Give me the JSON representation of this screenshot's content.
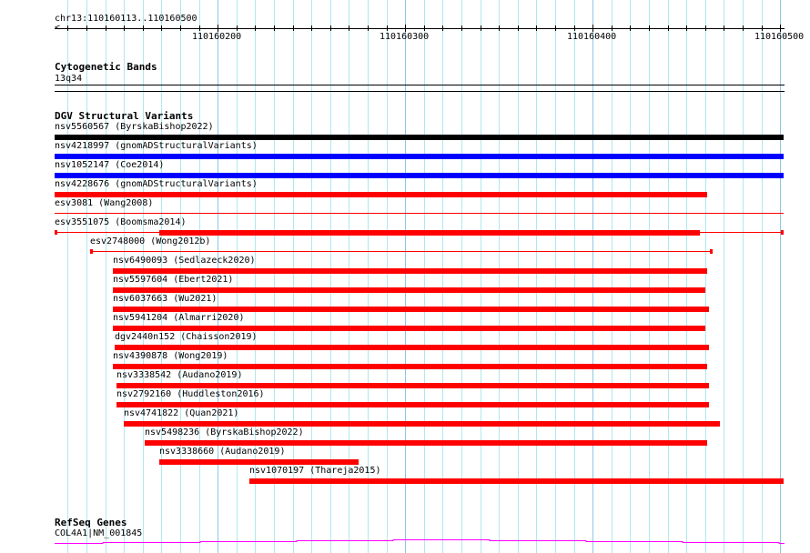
{
  "view": {
    "chrom": "chr13",
    "start": 110160113,
    "end": 110160500,
    "location_label": "chr13:110160113..110160500"
  },
  "ruler": {
    "major_ticks": [
      110160200,
      110160300,
      110160400,
      110160500
    ]
  },
  "tracks": {
    "cytoband": {
      "title": "Cytogenetic Bands",
      "band": "13q34"
    },
    "dgv": {
      "title": "DGV Structural Variants"
    },
    "refseq": {
      "title": "RefSeq Genes",
      "gene": "COL4A1|NM_001845"
    }
  },
  "colors": {
    "red": "#ff0000",
    "blue": "#0000ff",
    "black": "#000000",
    "gene": "#ff00ff"
  },
  "variants": [
    {
      "label": "nsv5560567 (ByrskaBishop2022)",
      "start": 110160113,
      "end": 110160502,
      "color": "black",
      "style": "thick"
    },
    {
      "label": "nsv4218997 (gnomADStructuralVariants)",
      "start": 110160113,
      "end": 110160502,
      "color": "blue",
      "style": "thick"
    },
    {
      "label": "nsv1052147 (Coe2014)",
      "start": 110160113,
      "end": 110160502,
      "color": "blue",
      "style": "thick"
    },
    {
      "label": "nsv4228676 (gnomADStructuralVariants)",
      "start": 110160113,
      "end": 110160461,
      "color": "red",
      "style": "thick"
    },
    {
      "label": "esv3081 (Wang2008)",
      "start": 110160113,
      "end": 110160502,
      "color": "red",
      "style": "thin"
    },
    {
      "label": "esv3551075 (Boomsma2014)",
      "start": 110160113,
      "end": 110160502,
      "color": "red",
      "style": "capped",
      "thick_start": 110160169,
      "thick_end": 110160457
    },
    {
      "label": "esv2748000 (Wong2012b)",
      "start": 110160132,
      "end": 110160464,
      "color": "red",
      "style": "capped"
    },
    {
      "label": "nsv6490093 (Sedlazeck2020)",
      "start": 110160144,
      "end": 110160461,
      "color": "red",
      "style": "thick"
    },
    {
      "label": "nsv5597604 (Ebert2021)",
      "start": 110160144,
      "end": 110160460,
      "color": "red",
      "style": "thick"
    },
    {
      "label": "nsv6037663 (Wu2021)",
      "start": 110160144,
      "end": 110160462,
      "color": "red",
      "style": "thick"
    },
    {
      "label": "nsv5941204 (Almarri2020)",
      "start": 110160144,
      "end": 110160460,
      "color": "red",
      "style": "thick"
    },
    {
      "label": "dgv2440n152 (Chaisson2019)",
      "start": 110160145,
      "end": 110160462,
      "color": "red",
      "style": "thick"
    },
    {
      "label": "nsv4390878 (Wong2019)",
      "start": 110160144,
      "end": 110160461,
      "color": "red",
      "style": "thick"
    },
    {
      "label": "nsv3338542 (Audano2019)",
      "start": 110160146,
      "end": 110160462,
      "color": "red",
      "style": "thick"
    },
    {
      "label": "nsv2792160 (Huddleston2016)",
      "start": 110160146,
      "end": 110160462,
      "color": "red",
      "style": "thick"
    },
    {
      "label": "nsv4741822 (Quan2021)",
      "start": 110160150,
      "end": 110160468,
      "color": "red",
      "style": "thick"
    },
    {
      "label": "nsv5498236 (ByrskaBishop2022)",
      "start": 110160161,
      "end": 110160461,
      "color": "red",
      "style": "thick"
    },
    {
      "label": "nsv3338660 (Audano2019)",
      "start": 110160169,
      "end": 110160275,
      "color": "red",
      "style": "thick"
    },
    {
      "label": "nsv1070197 (Thareja2015)",
      "start": 110160217,
      "end": 110160502,
      "color": "red",
      "style": "thick"
    }
  ]
}
